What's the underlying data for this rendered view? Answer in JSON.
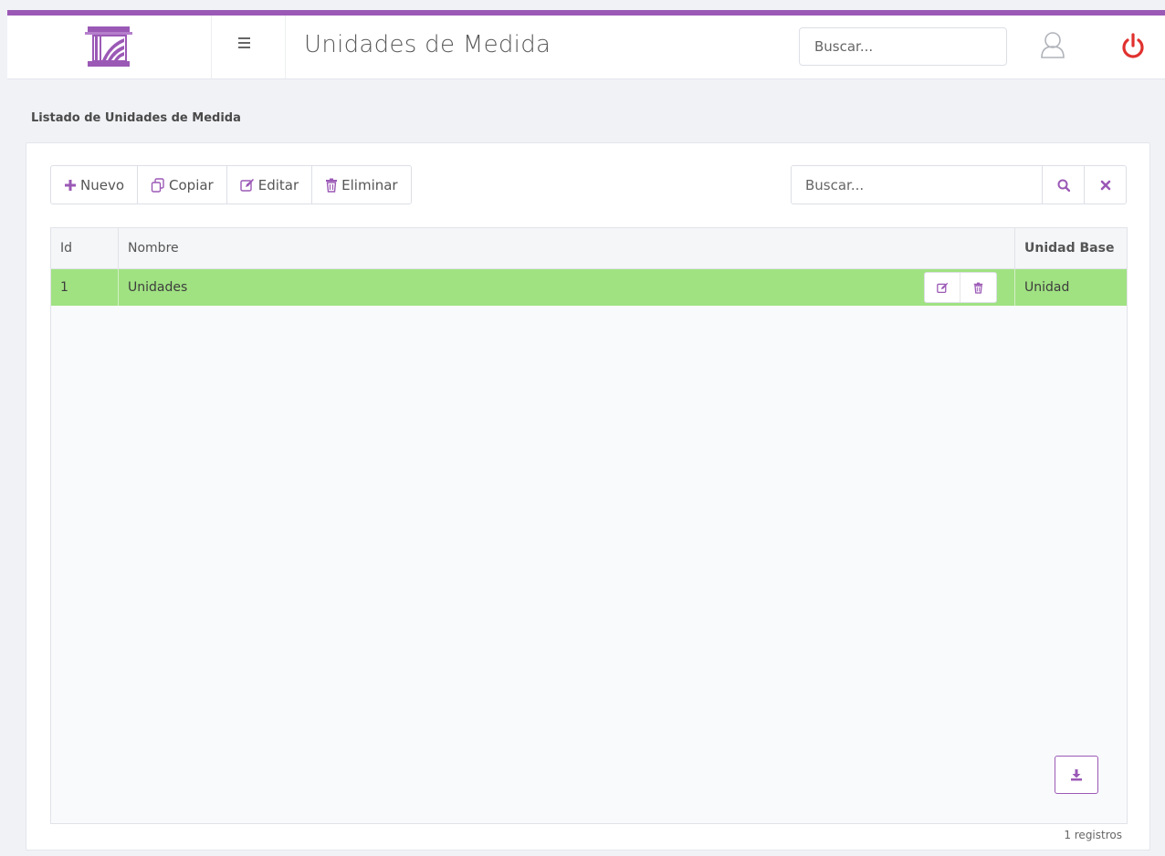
{
  "app": {
    "title": "Unidades de Medida",
    "search_placeholder": "Buscar...",
    "accent_color": "#9b59b6",
    "power_color": "#e0312e"
  },
  "icons": {
    "logo": "pillar-logo-icon",
    "menu": "hamburger-menu-icon",
    "user": "user-icon",
    "power": "power-icon",
    "add": "plus-icon",
    "copy": "copy-icon",
    "edit": "edit-icon",
    "delete": "trash-icon",
    "search": "search-icon",
    "clear": "close-icon",
    "export": "download-icon"
  },
  "section": {
    "title": "Listado de Unidades de Medida"
  },
  "toolbar": {
    "new_label": "Nuevo",
    "copy_label": "Copiar",
    "edit_label": "Editar",
    "delete_label": "Eliminar"
  },
  "grid_search": {
    "placeholder": "Buscar..."
  },
  "table": {
    "columns": [
      "Id",
      "Nombre",
      "Unidad Base"
    ],
    "rows": [
      {
        "id": "1",
        "nombre": "Unidades",
        "unidad_base": "Unidad",
        "selected": true
      }
    ],
    "selected_row_color": "#a0e282"
  },
  "footer": {
    "count_text": "1 registros"
  }
}
